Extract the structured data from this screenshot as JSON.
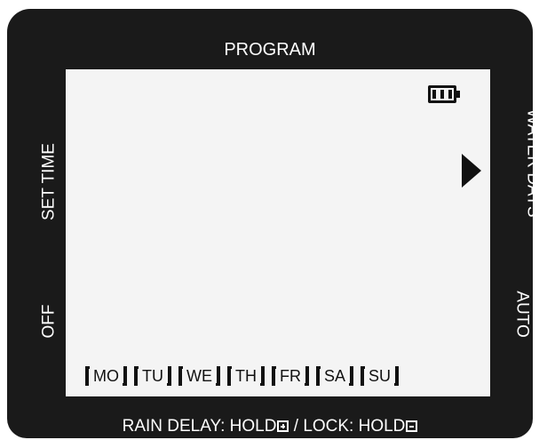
{
  "bezel": {
    "top_label": "PROGRAM",
    "left_labels": [
      "SET TIME",
      "OFF"
    ],
    "right_labels": [
      "WATER DAYS",
      "AUTO"
    ],
    "bottom": {
      "rain_delay": "RAIN DELAY: HOLD",
      "rain_delay_icon": "plus-box-icon",
      "separator": " / ",
      "lock": "LOCK: HOLD",
      "lock_icon": "minus-box-icon"
    }
  },
  "screen": {
    "battery_icon": "battery-full-icon",
    "indicator_icon": "triangle-right-icon",
    "days": [
      "MO",
      "TU",
      "WE",
      "TH",
      "FR",
      "SA",
      "SU"
    ]
  },
  "colors": {
    "bezel": "#1a1a1a",
    "screen": "#f4f4f4",
    "text_on_bezel": "#ffffff",
    "text_on_screen": "#111111"
  }
}
